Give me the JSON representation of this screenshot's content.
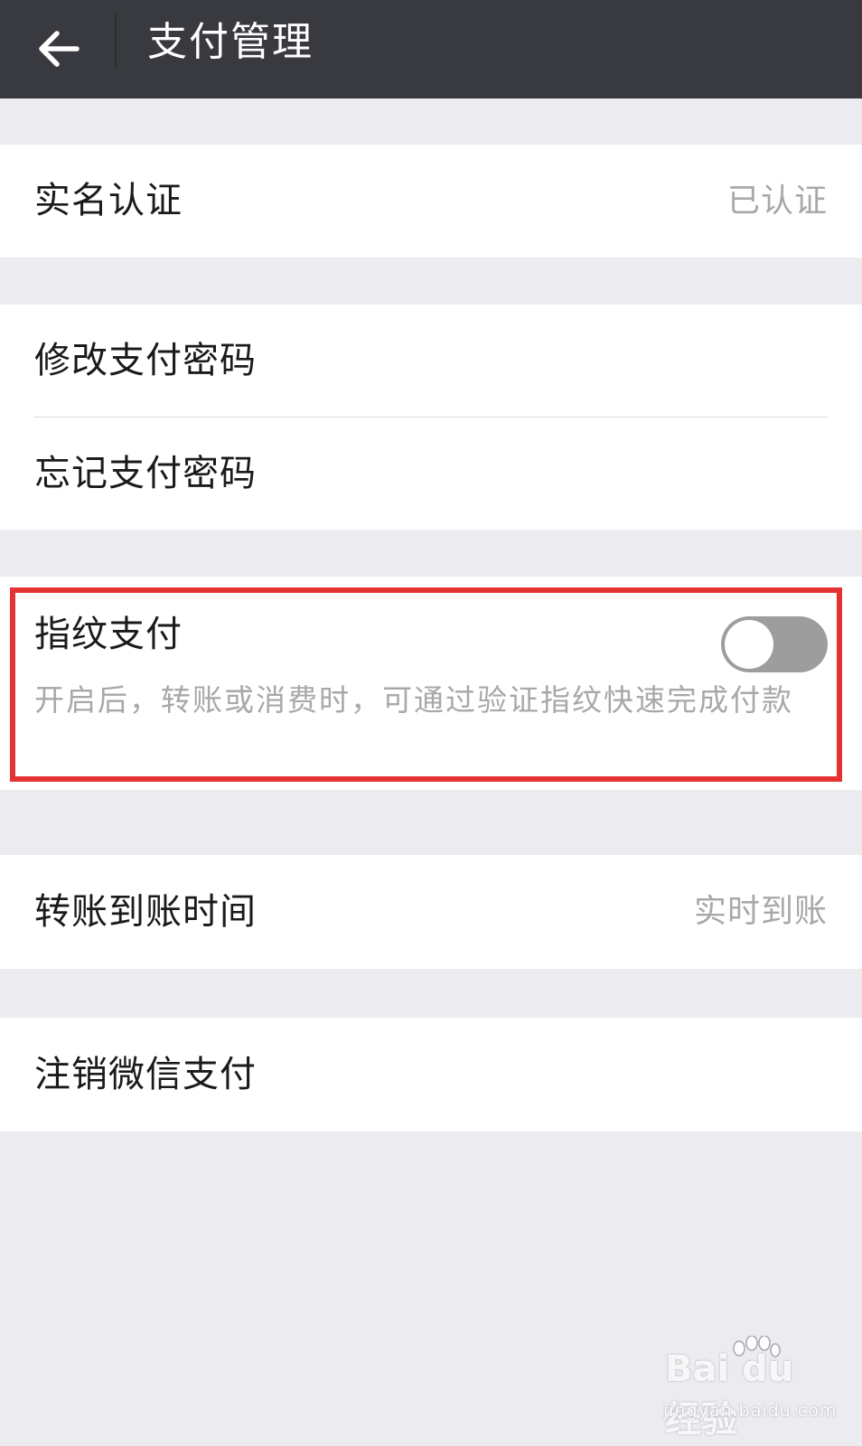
{
  "header": {
    "back_icon": "arrow-left-icon",
    "title": "支付管理"
  },
  "colors": {
    "header_bg": "#393a3f",
    "page_bg": "#ebebf0",
    "highlight_border": "#e53232",
    "toggle_off": "#9d9d9d"
  },
  "rows": {
    "real_name": {
      "label": "实名认证",
      "value": "已认证"
    },
    "change_password": {
      "label": "修改支付密码"
    },
    "forgot_password": {
      "label": "忘记支付密码"
    },
    "fingerprint": {
      "label": "指纹支付",
      "description": "开启后，转账或消费时，可通过验证指纹快速完成付款",
      "toggle_on": false
    },
    "transfer_time": {
      "label": "转账到账时间",
      "value": "实时到账"
    },
    "deactivate": {
      "label": "注销微信支付"
    }
  },
  "watermark": {
    "logo_text": "Bai du 经验",
    "url_text": "jingyan.baidu.com"
  }
}
